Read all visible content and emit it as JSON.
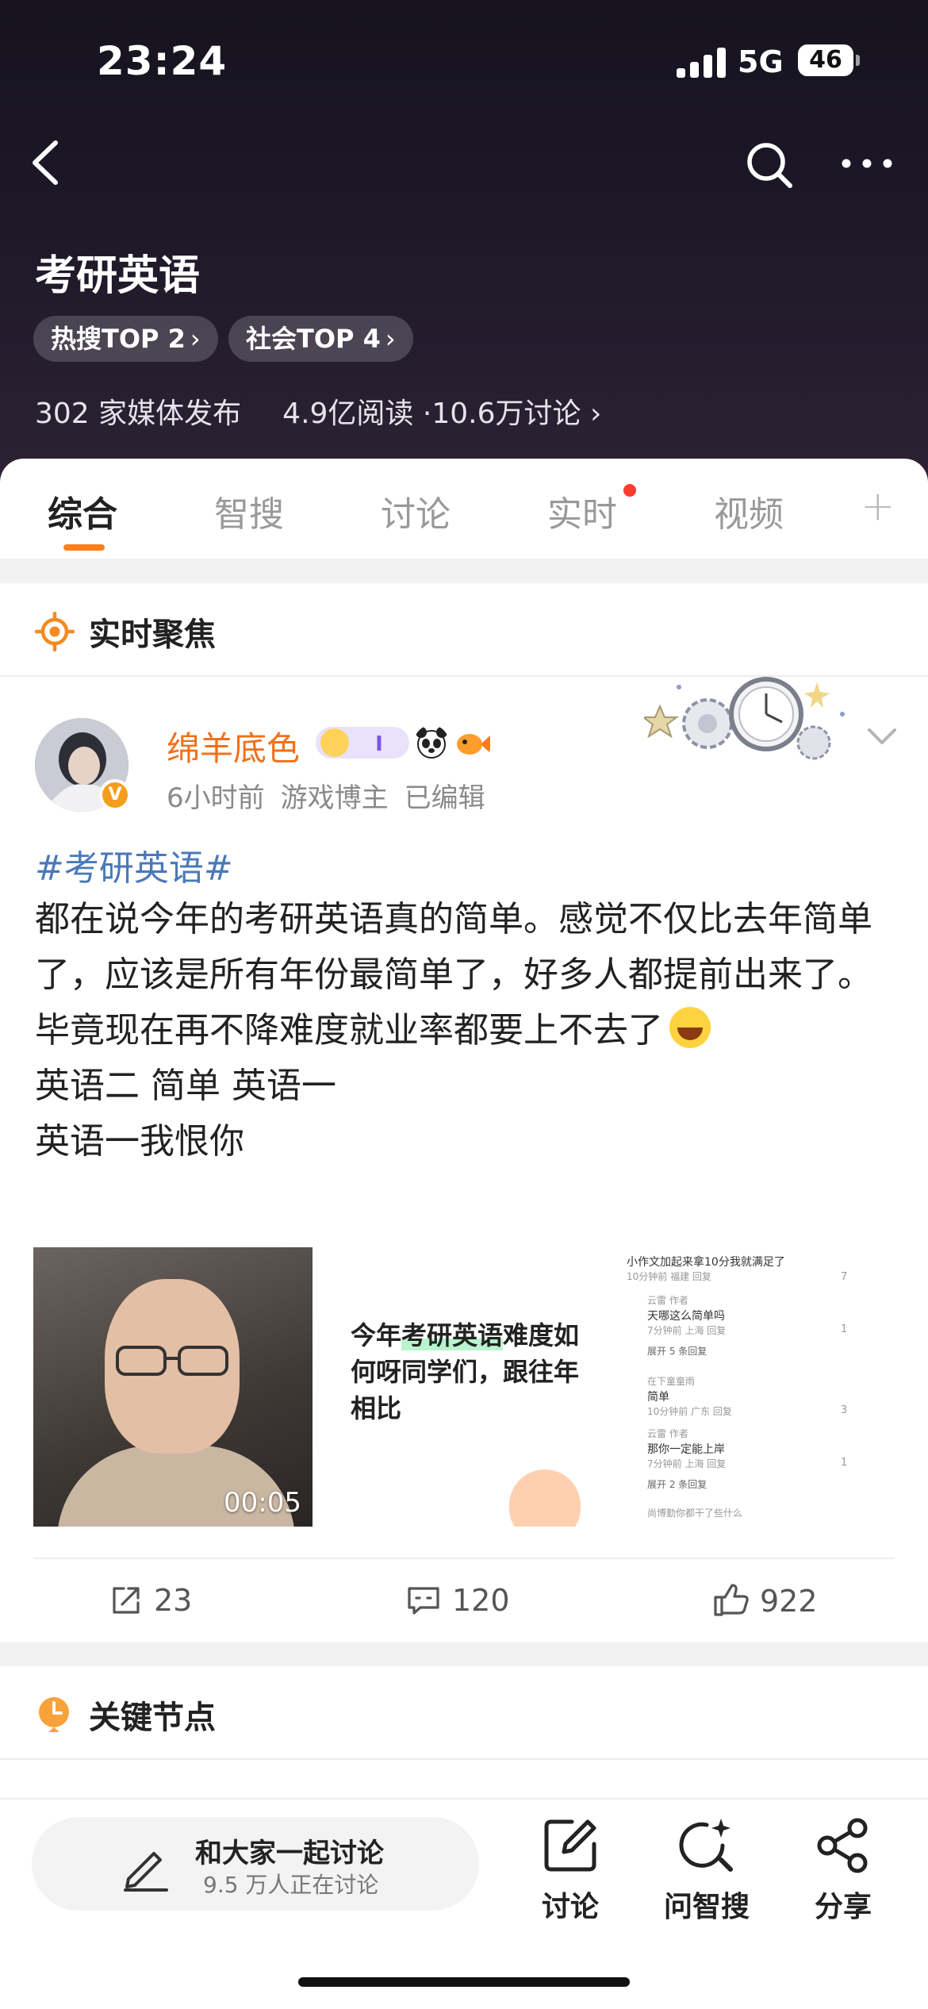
{
  "status_bar": {
    "time": "23:24",
    "network": "5G",
    "battery": "46"
  },
  "header": {
    "title": "考研英语",
    "chips": [
      {
        "label": "热搜TOP 2"
      },
      {
        "label": "社会TOP 4"
      }
    ],
    "stats": {
      "media": "302 家媒体发布",
      "reads": "4.9亿阅读",
      "discussions": "·10.6万讨论"
    }
  },
  "tabs": [
    {
      "label": "综合",
      "active": true
    },
    {
      "label": "智搜",
      "active": false
    },
    {
      "label": "讨论",
      "active": false
    },
    {
      "label": "实时",
      "active": false,
      "dot": true
    },
    {
      "label": "视频",
      "active": false
    }
  ],
  "tab_plus": "+",
  "focus": {
    "title": "实时聚焦"
  },
  "post": {
    "username": "绵羊底色",
    "avatar_badge": "V",
    "meta": {
      "time": "6小时前",
      "role": "游戏博主",
      "edited": "已编辑"
    },
    "hashtag": "#考研英语#",
    "body": [
      "都在说今年的考研英语真的简单。感觉不仅比去年简单了，应该是所有年份最简单了，好多人都提前出来了。",
      "毕竟现在再不降难度就业率都要上不去了",
      "英语二 简单 英语一",
      "英语一我恨你"
    ],
    "media": {
      "video_duration": "00:05",
      "image_text_plain1": "今年",
      "image_text_highlight": "考研英语",
      "image_text_plain2": "难度如何呀同学们，跟往年相比",
      "comments_preview": [
        "小作文加起来拿10分我就满足了",
        "10分钟前 福建  回复",
        "云雷  作者",
        "天哪这么简单吗",
        "7分钟前 上海  回复",
        "展开 5 条回复",
        "在下童童雨",
        "简单",
        "10分钟前 广东  回复",
        "云雷  作者",
        "那你一定能上岸",
        "7分钟前 上海  回复",
        "展开 2 条回复",
        "尚博勤你都干了些什么"
      ],
      "comment_likes": [
        "7",
        "1",
        "3",
        "1"
      ]
    },
    "actions": {
      "reposts": "23",
      "comments": "120",
      "likes": "922"
    }
  },
  "key_nodes": {
    "title": "关键节点"
  },
  "bottom": {
    "discuss_title": "和大家一起讨论",
    "discuss_sub": "9.5 万人正在讨论",
    "buttons": [
      {
        "label": "讨论",
        "icon": "edit-square-icon"
      },
      {
        "label": "问智搜",
        "icon": "smart-search-icon"
      },
      {
        "label": "分享",
        "icon": "share-icon"
      }
    ]
  },
  "colors": {
    "accent": "#ff7f1e",
    "username": "#f0701c",
    "hashtag": "#4a79b8",
    "header_bg": "#1d1828"
  }
}
